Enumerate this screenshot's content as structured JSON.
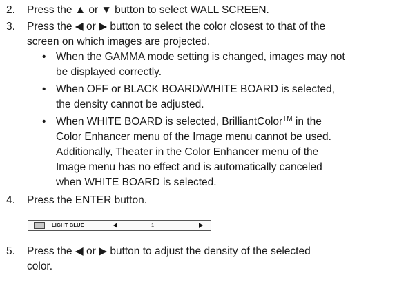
{
  "steps": [
    {
      "number": "2.",
      "text": "Press the ▲ or ▼ button to select WALL SCREEN."
    },
    {
      "number": "3.",
      "line1": "Press the ◀ or ▶ button to select the color closest to that of the",
      "line2": "screen on which images are projected."
    },
    {
      "number": "4.",
      "text": "Press the ENTER button."
    },
    {
      "number": "5.",
      "line1": "Press the ◀ or ▶ button to adjust the density of the selected",
      "line2": "color."
    }
  ],
  "bullets": [
    {
      "symbol": "•",
      "line1": "When the GAMMA mode setting is changed, images may not",
      "line2": "be displayed correctly."
    },
    {
      "symbol": "•",
      "line1": "When OFF or BLACK BOARD/WHITE BOARD is selected,",
      "line2": "the density cannot be adjusted."
    },
    {
      "symbol": "•",
      "line1a": "When WHITE BOARD is selected, BrilliantColor",
      "line1sup": "TM",
      "line1b": " in the",
      "line2": "Color Enhancer menu of the Image menu cannot be used.",
      "line3": "Additionally, Theater in the Color Enhancer menu of the",
      "line4": "Image menu has no effect and is automatically canceled",
      "line5": "when WHITE BOARD is selected."
    }
  ],
  "osd": {
    "label": "LIGHT BLUE",
    "value": "1",
    "swatch_color": "#c8c8c8"
  }
}
